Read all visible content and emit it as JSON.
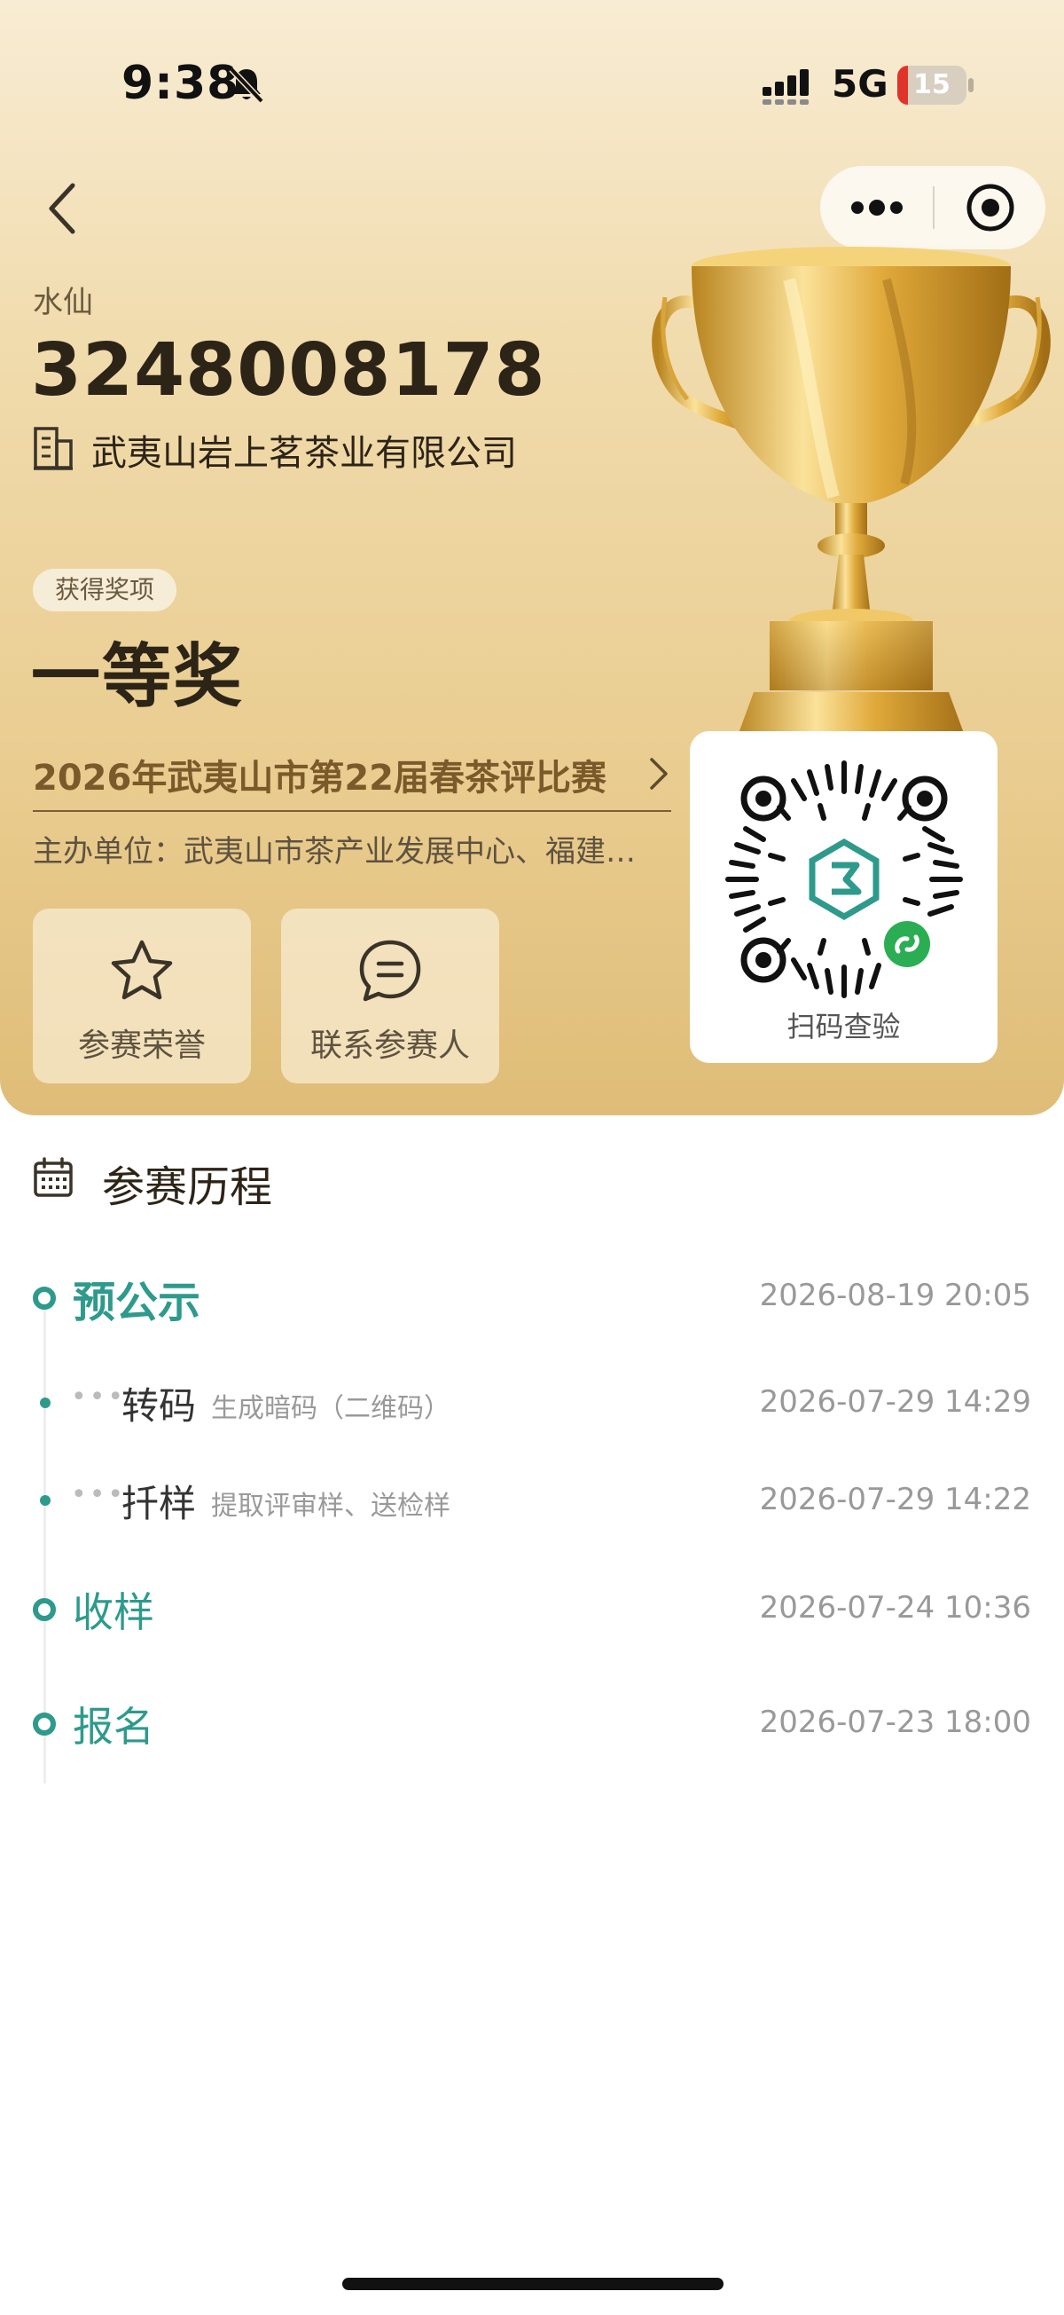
{
  "status_bar": {
    "time": "9:38",
    "network": "5G",
    "battery_level": 15,
    "battery_text": "15",
    "battery_color": "#e0342a"
  },
  "nav": {
    "back_icon": "chevron-left-icon",
    "more_icon": "more-dots-icon",
    "target_icon": "target-icon"
  },
  "product": {
    "variety": "水仙",
    "sample_number": "3248008178",
    "company": "武夷山岩上茗茶业有限公司"
  },
  "award": {
    "chip_label": "获得奖项",
    "name": "一等奖"
  },
  "contest": {
    "name": "2026年武夷山市第22届春茶评比赛",
    "organizer": "主办单位：武夷山市茶产业发展中心、福建…"
  },
  "actions": [
    {
      "label": "参赛荣誉",
      "icon": "star-icon"
    },
    {
      "label": "联系参赛人",
      "icon": "chat-bubble-icon"
    }
  ],
  "qr": {
    "label": "扫码查验",
    "icon": "mini-program-qr-code"
  },
  "history": {
    "title": "参赛历程",
    "icon": "calendar-icon",
    "stages": [
      {
        "label": "预公示",
        "time": "2026-08-19 20:05"
      },
      {
        "label": "转码",
        "desc": "生成暗码（二维码）",
        "time": "2026-07-29 14:29"
      },
      {
        "label": "扦样",
        "desc": "提取评审样、送检样",
        "time": "2026-07-29 14:22"
      },
      {
        "label": "收样",
        "time": "2026-07-24 10:36"
      },
      {
        "label": "报名",
        "time": "2026-07-23 18:00"
      }
    ]
  },
  "colors": {
    "accent_teal": "#2e9a8c",
    "gold_text": "#7a5a2a",
    "hero_gold": "#e9cc8f"
  }
}
